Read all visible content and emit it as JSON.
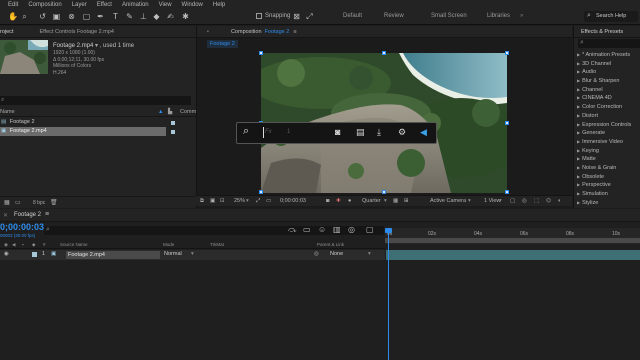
{
  "menu": [
    "Edit",
    "Composition",
    "Layer",
    "Effect",
    "Animation",
    "View",
    "Window",
    "Help"
  ],
  "toolbar": {
    "snapping_label": "Snapping",
    "workspaces": [
      "Default",
      "Review",
      "Small Screen",
      "Libraries"
    ],
    "search_help_placeholder": "Search Help"
  },
  "project_panel": {
    "tab_project": "roject",
    "tab_effect_controls": "Effect Controls Footage 2.mp4",
    "selected_name": "Footage 2.mp4",
    "used_label": "used 1 time",
    "details": [
      "1920 x 1080 (1.00)",
      "Δ 0;00;12;11, 30.00 fps",
      "Millions of Colors",
      "H.264"
    ],
    "col_name": "Name",
    "col_comment": "Comm",
    "items": [
      {
        "name": "Footage 2",
        "selected": false
      },
      {
        "name": "Footage 2.mp4",
        "selected": true
      }
    ],
    "bpc": "8 bpc"
  },
  "composition_panel": {
    "tab_prefix": "Composition",
    "tab_name": "Footage 2",
    "breadcrumb": "Footage 2",
    "zoom": "25%",
    "timecode": "0;00:00:03",
    "resolution": "Quarter",
    "camera": "Active Camera",
    "views": "1 View"
  },
  "search_bar": {
    "placeholder": "Fx",
    "icons": [
      "search-icon",
      "camera-icon",
      "film-icon",
      "download-icon",
      "gear-icon",
      "send-icon"
    ]
  },
  "effects_panel": {
    "title": "Effects & Presets",
    "search_value": "",
    "categories": [
      "* Animation Presets",
      "3D Channel",
      "Audio",
      "Blur & Sharpen",
      "Channel",
      "CINEMA 4D",
      "Color Correction",
      "Distort",
      "Expression Controls",
      "Generate",
      "Immersive Video",
      "Keying",
      "Matte",
      "Noise & Grain",
      "Obsolete",
      "Perspective",
      "Simulation",
      "Stylize"
    ]
  },
  "timeline": {
    "tab": "Footage 2",
    "current_time": "0;00:00:03",
    "frame_info": "00003 (30.00 fps)",
    "col_source_name": "Source Name",
    "col_mode": "Mode",
    "col_trkmat": "TrkMat",
    "col_parent": "Parent & Link",
    "layer": {
      "index": "1",
      "name": "Footage 2.mp4",
      "mode": "Normal",
      "parent": "None"
    },
    "ruler": [
      "0s",
      "02s",
      "04s",
      "06s",
      "08s",
      "10s"
    ]
  },
  "colors": {
    "accent": "#2d8ceb",
    "panel": "#232323",
    "bg": "#1d1d1d",
    "layer_bar": "#3d6f75"
  }
}
